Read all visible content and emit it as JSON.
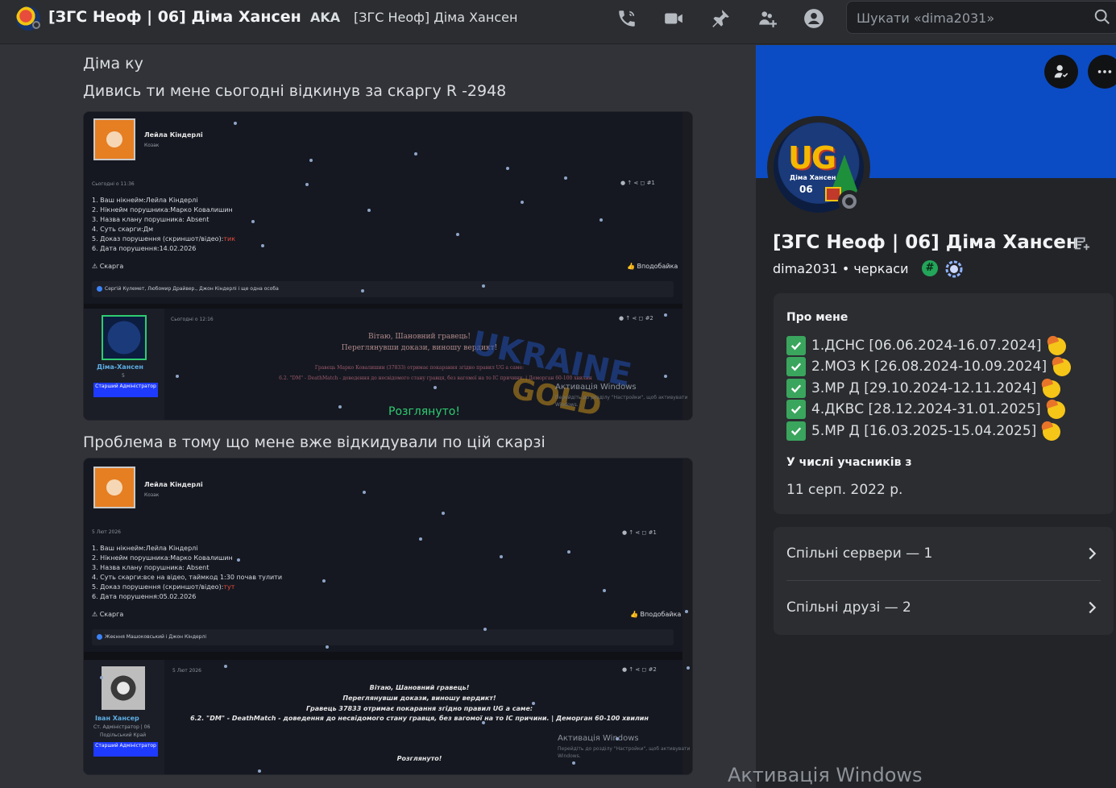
{
  "header": {
    "channel_title": "[ЗГС Неоф | 06] Діма Хансен",
    "aka_label": "AKA",
    "aka_name": "[ЗГС Неоф] Діма Хансен",
    "icons": [
      "phone-call-icon",
      "video-camera-icon",
      "pin-icon",
      "add-friends-icon",
      "user-profile-icon"
    ],
    "search_placeholder": "Шукати «dima2031»"
  },
  "chat": {
    "messages": [
      {
        "text": "Діма ку"
      },
      {
        "text": "Дивись ти мене сьогодні відкинув за скаргу R -2948"
      },
      {
        "text": "Проблема в тому що мене вже відкидували по цій скарзі"
      }
    ],
    "screenshot1": {
      "post1": {
        "author": "Лейла Кіндерлі",
        "author_role": "Козак",
        "time": "Сьогодні о 11:36",
        "post_number": "#1",
        "lines": [
          "1. Ваш нікнейм:Лейла Кіндерлі",
          "2. Нікнейм порушника:Марко Ковалишин",
          "3. Назва клану порушника: Absent",
          "4. Суть скарги:Дм",
          "5. Доказ порушення (скриншот/відео):"
        ],
        "link_text": "тик",
        "date_line": "6. Дата порушення:14.02.2026",
        "complaint_label": "Скарга",
        "like_label": "Вподобайка",
        "reactions": "Сергій Кулемет, Любомир Драйвер., Джон Кіндерлі і ще одна особа"
      },
      "post2": {
        "author": "Діма-Хансен",
        "author_count": "5",
        "badge": "Старший Адміністратор",
        "time": "Сьогодні о 12:16",
        "post_number": "#2",
        "greeting": "Вітаю, Шановний гравець!",
        "verdict": "Переглянувши докази, виношу вердикт!",
        "details": "Гравець Марко Ковалишин (37833) отримає покарання згідно правил UG а саме:",
        "rule": "6.2. \"DM\" - DeathMatch - доведення до несвідомого стану гравця, без вагомої на то IC причини. | Деморган 60-100 хвилин",
        "status": "Розглянуто!",
        "watermark": "Активація Windows",
        "watermark_sub": "Перейдіть до розділу \"Настройки\", щоб активувати Windows."
      }
    },
    "screenshot2": {
      "post1": {
        "author": "Лейла Кіндерлі",
        "author_role": "Козак",
        "time": "5 Лют 2026",
        "post_number": "#1",
        "lines": [
          "1. Ваш нікнейм:Лейла Кіндерлі",
          "2. Нікнейм порушника:Марко Ковалишин",
          "3. Назва клану порушника: Absent",
          "4. Суть скарги:все на відео, таймкод 1:30 почав тулити",
          "5. Доказ порушення (скриншот/відео):"
        ],
        "link_text": "тут",
        "date_line": "6. Дата порушення:05.02.2026",
        "complaint_label": "Скарга",
        "like_label": "Вподобайка",
        "reactions": "Жеєння Машоковський і Джон Кіндерлі"
      },
      "post2": {
        "author": "Іван Хансер",
        "role1": "Ст. Адміністратор | 06",
        "role2": "Подільський Край",
        "badge": "Старший Адміністратор",
        "time": "5 Лют 2026",
        "post_number": "#2",
        "greeting": "Вітаю, Шановний гравець!",
        "verdict": "Переглянувши докази, виношу вердикт!",
        "details": "Гравець 37833 отримає покарання згідно правил UG а саме:",
        "rule": "6.2. \"DM\" - DeathMatch - доведення до несвідомого стану гравця, без вагомої на то IC причини. | Деморган 60-100 хвилин",
        "status": "Розглянуто!",
        "watermark": "Активація Windows",
        "watermark_sub": "Перейдіть до розділу \"Настройки\", щоб активувати Windows."
      }
    }
  },
  "profile": {
    "banner_color": "#0b4cc4",
    "display_name": "[ЗГС Неоф | 06] Діма Хансен",
    "avatar_text": "UG",
    "avatar_caption": "Діма Хансен",
    "avatar_number": "06",
    "username": "dima2031",
    "separator": "•",
    "location": "черкаси",
    "hashtag_badge": "#",
    "about_title": "Про мене",
    "about_lines": [
      "1.ДСНС [06.06.2024-16.07.2024]",
      "2.МОЗ К [26.08.2024-10.09.2024]",
      "3.МР Д [29.10.2024-12.11.2024]",
      "4.ДКВС [28.12.2024-31.01.2025]",
      "5.МР Д [16.03.2025-15.04.2025]"
    ],
    "member_since_title": "У числі учасників з",
    "member_since_date": "11 серп. 2022 р.",
    "mutual_servers": "Спільні сервери — 1",
    "mutual_friends": "Спільні друзі — 2"
  },
  "windows_watermark": "Активація Windows"
}
